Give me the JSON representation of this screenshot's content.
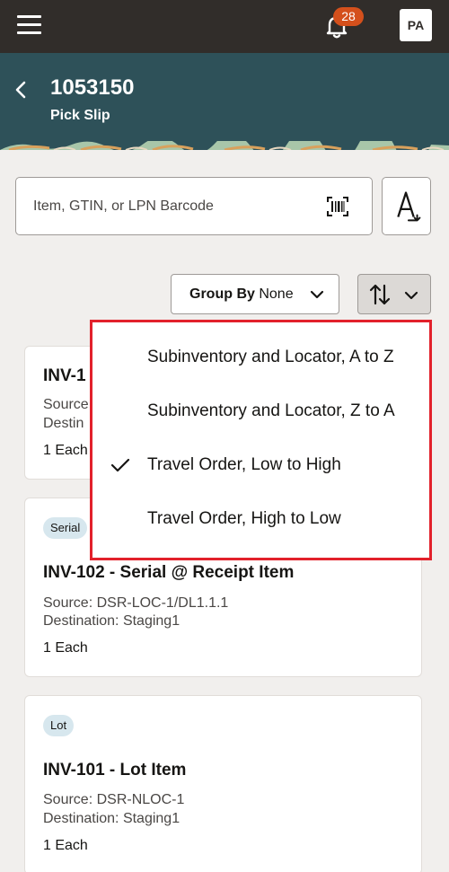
{
  "topbar": {
    "notification_count": "28",
    "avatar_initials": "PA"
  },
  "header": {
    "title": "1053150",
    "subtitle": "Pick Slip"
  },
  "search": {
    "placeholder": "Item, GTIN, or LPN Barcode"
  },
  "toolbar": {
    "group_by_label": "Group By",
    "group_by_value": "None"
  },
  "sort_menu": {
    "items": [
      {
        "label": "Subinventory and Locator, A to Z",
        "selected": false
      },
      {
        "label": "Subinventory and Locator, Z to A",
        "selected": false
      },
      {
        "label": "Travel Order, Low to High",
        "selected": true
      },
      {
        "label": "Travel Order, High to Low",
        "selected": false
      }
    ]
  },
  "cards": [
    {
      "title": "INV-1",
      "source": "Source",
      "destination": "Destin",
      "quantity": "1 Each"
    },
    {
      "tag": "Serial",
      "title": "INV-102 - Serial @ Receipt Item",
      "source": "Source: DSR-LOC-1/DL1.1.1",
      "destination": "Destination: Staging1",
      "quantity": "1 Each"
    },
    {
      "tag": "Lot",
      "title": "INV-101 - Lot Item",
      "source": "Source: DSR-NLOC-1",
      "destination": "Destination: Staging1",
      "quantity": "1 Each"
    }
  ],
  "colors": {
    "topbar": "#312d2a",
    "header": "#2e5159",
    "badge": "#d4501c",
    "highlight_border": "#e2212b",
    "tag_bg": "#d7e7ee"
  },
  "icons": [
    "menu-icon",
    "bell-icon",
    "back-chevron-icon",
    "barcode-scan-icon",
    "sort-az-icon",
    "chevron-down-icon",
    "sort-arrows-icon",
    "checkmark-icon"
  ]
}
